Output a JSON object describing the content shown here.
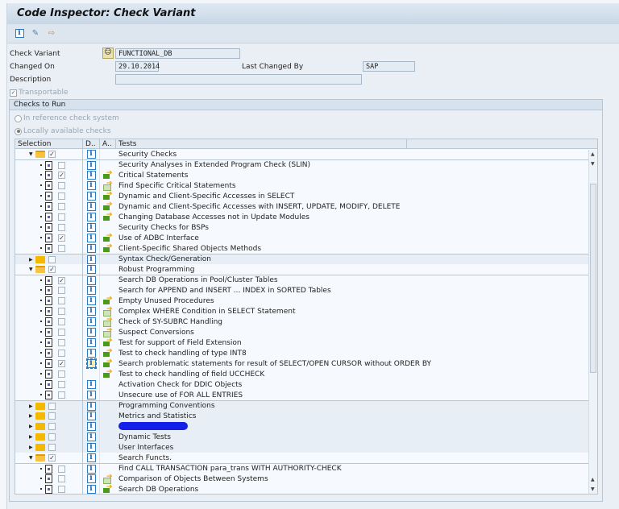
{
  "title": "Code Inspector: Check Variant",
  "toolbar": [
    {
      "icon": "info-icon"
    },
    {
      "icon": "glasses-edit-icon"
    },
    {
      "icon": "transport-icon"
    }
  ],
  "form": {
    "check_variant_label": "Check Variant",
    "check_variant_value": "FUNCTIONAL_DB",
    "changed_on_label": "Changed On",
    "changed_on_value": "29.10.2014",
    "last_changed_by_label": "Last Changed By",
    "last_changed_by_value": "SAP",
    "description_label": "Description",
    "description_value": "",
    "transportable_label": "Transportable",
    "transportable_checked": true
  },
  "checks": {
    "group_title": "Checks to Run",
    "radio_reference": "In reference check system",
    "radio_local": "Locally available checks",
    "selected_radio": "local",
    "columns": [
      "Selection",
      "D..",
      "A..",
      "Tests"
    ],
    "rows": [
      {
        "kind": "folder",
        "open": true,
        "checked": true,
        "info": true,
        "action": "",
        "label": "Security Checks"
      },
      {
        "kind": "doc",
        "checked": false,
        "info": true,
        "action": "",
        "label": "Security Analyses in Extended Program Check (SLIN)"
      },
      {
        "kind": "doc",
        "checked": true,
        "info": true,
        "action": "green",
        "label": "Critical Statements"
      },
      {
        "kind": "doc",
        "checked": false,
        "info": true,
        "action": "pale",
        "label": "Find Specific Critical Statements"
      },
      {
        "kind": "doc",
        "checked": false,
        "info": true,
        "action": "green",
        "label": "Dynamic and Client-Specific Accesses in SELECT"
      },
      {
        "kind": "doc",
        "checked": false,
        "info": true,
        "action": "green",
        "label": "Dynamic and Client-Specific Accesses with INSERT, UPDATE, MODIFY, DELETE"
      },
      {
        "kind": "doc",
        "checked": false,
        "info": true,
        "action": "green",
        "label": "Changing Database Accesses not in Update Modules"
      },
      {
        "kind": "doc",
        "checked": false,
        "info": true,
        "action": "",
        "label": "Security Checks for BSPs"
      },
      {
        "kind": "doc",
        "checked": true,
        "info": true,
        "action": "green",
        "label": "Use of ADBC Interface"
      },
      {
        "kind": "doc",
        "checked": false,
        "info": true,
        "action": "green",
        "label": "Client-Specific Shared Objects Methods"
      },
      {
        "kind": "folder",
        "open": false,
        "checked": false,
        "info": true,
        "action": "",
        "label": "Syntax Check/Generation"
      },
      {
        "kind": "folder",
        "open": true,
        "checked": true,
        "info": true,
        "action": "",
        "label": "Robust Programming"
      },
      {
        "kind": "doc",
        "checked": true,
        "info": true,
        "action": "",
        "label": "Search DB Operations in Pool/Cluster Tables"
      },
      {
        "kind": "doc",
        "checked": false,
        "info": true,
        "action": "",
        "label": "Search for APPEND and INSERT ... INDEX in SORTED Tables"
      },
      {
        "kind": "doc",
        "checked": false,
        "info": true,
        "action": "green",
        "label": "Empty Unused Procedures"
      },
      {
        "kind": "doc",
        "checked": false,
        "info": true,
        "action": "pale",
        "label": "Complex WHERE Condition in SELECT Statement"
      },
      {
        "kind": "doc",
        "checked": false,
        "info": true,
        "action": "pale",
        "label": "Check of SY-SUBRC Handling"
      },
      {
        "kind": "doc",
        "checked": false,
        "info": true,
        "action": "pale",
        "label": "Suspect Conversions"
      },
      {
        "kind": "doc",
        "checked": false,
        "info": true,
        "action": "green",
        "label": "Test for support of Field Extension"
      },
      {
        "kind": "doc",
        "checked": false,
        "info": true,
        "action": "green",
        "label": "Test to check handling of type INT8"
      },
      {
        "kind": "doc",
        "checked": true,
        "info": true,
        "info_focused": true,
        "action": "green",
        "label": "Search problematic statements for result of SELECT/OPEN CURSOR without ORDER BY"
      },
      {
        "kind": "doc",
        "checked": false,
        "info": false,
        "action": "green",
        "label": "Test to check handling of field UCCHECK"
      },
      {
        "kind": "doc",
        "checked": false,
        "info": true,
        "action": "",
        "label": "Activation Check for DDIC Objects"
      },
      {
        "kind": "doc",
        "checked": false,
        "info": true,
        "action": "",
        "label": "Unsecure use of FOR ALL ENTRIES"
      },
      {
        "kind": "folder",
        "open": false,
        "checked": false,
        "info": true,
        "action": "",
        "label": "Programming Conventions"
      },
      {
        "kind": "folder",
        "open": false,
        "checked": false,
        "info": true,
        "action": "",
        "label": "Metrics and Statistics"
      },
      {
        "kind": "folder",
        "open": false,
        "checked": false,
        "info": true,
        "action": "",
        "label": "",
        "redacted": true
      },
      {
        "kind": "folder",
        "open": false,
        "checked": false,
        "info": true,
        "action": "",
        "label": "Dynamic Tests"
      },
      {
        "kind": "folder",
        "open": false,
        "checked": false,
        "info": true,
        "action": "",
        "label": "User Interfaces"
      },
      {
        "kind": "folder",
        "open": true,
        "checked": true,
        "info": true,
        "action": "",
        "label": "Search Functs."
      },
      {
        "kind": "doc",
        "checked": false,
        "info": true,
        "action": "",
        "label": "Find CALL TRANSACTION para_trans WITH AUTHORITY-CHECK"
      },
      {
        "kind": "doc",
        "checked": false,
        "info": true,
        "action": "pale",
        "label": "Comparison of Objects Between Systems"
      },
      {
        "kind": "doc",
        "checked": false,
        "info": true,
        "action": "green",
        "label": "Search DB Operations"
      }
    ]
  }
}
